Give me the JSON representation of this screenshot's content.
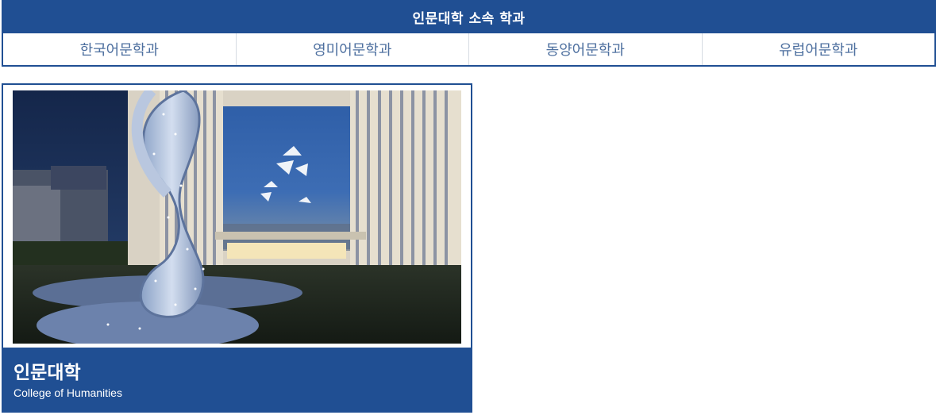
{
  "department_nav": {
    "header": "인문대학 소속 학과",
    "tabs": [
      {
        "label": "한국어문학과"
      },
      {
        "label": "영미어문학과"
      },
      {
        "label": "동양어문학과"
      },
      {
        "label": "유럽어문학과"
      }
    ]
  },
  "college_card": {
    "title": "인문대학",
    "subtitle": "College of Humanities",
    "image": "campus-night-photo"
  },
  "colors": {
    "brand_blue": "#204f93",
    "tab_text": "#4d6f9f"
  }
}
